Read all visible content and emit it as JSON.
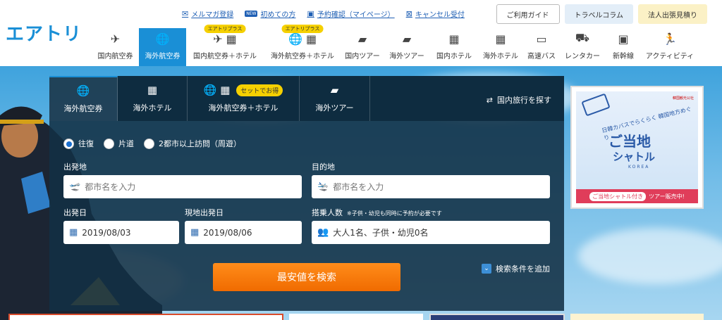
{
  "logo": "エアトリ",
  "toplinks": [
    {
      "icon": "mail-icon",
      "label": "メルマガ登録"
    },
    {
      "icon": "new-badge-icon",
      "badge": "NEW",
      "label": "初めての方"
    },
    {
      "icon": "calendar-check-icon",
      "label": "予約確認（マイページ）"
    },
    {
      "icon": "calendar-cancel-icon",
      "label": "キャンセル受付"
    }
  ],
  "topbuttons": {
    "guide": "ご利用ガイド",
    "travel": "トラベルコラム",
    "corporate": "法人出張見積り"
  },
  "nav": [
    {
      "icon": "airplane-icon",
      "label": "国内航空券",
      "active": false
    },
    {
      "icon": "globe-plane-icon",
      "label": "海外航空券",
      "active": true
    },
    {
      "icon": "airplane-hotel-icon",
      "label": "国内航空券＋ホテル",
      "badge": "エアトリプラス"
    },
    {
      "icon": "globe-hotel-icon",
      "label": "海外航空券＋ホテル",
      "badge": "エアトリプラス"
    },
    {
      "icon": "suitcase-icon",
      "label": "国内ツアー"
    },
    {
      "icon": "globe-suitcase-icon",
      "label": "海外ツアー"
    },
    {
      "icon": "hotel-icon",
      "label": "国内ホテル"
    },
    {
      "icon": "building-icon",
      "label": "海外ホテル"
    },
    {
      "icon": "bus-icon",
      "label": "高速バス"
    },
    {
      "icon": "car-icon",
      "label": "レンタカー"
    },
    {
      "icon": "train-icon",
      "label": "新幹線"
    },
    {
      "icon": "running-icon",
      "label": "アクティビティ"
    }
  ],
  "search": {
    "tabs": [
      {
        "icon": "globe-plane-icon",
        "label": "海外航空券"
      },
      {
        "icon": "building-icon",
        "label": "海外ホテル"
      },
      {
        "icon": "globe-hotel-icon",
        "label": "海外航空券＋ホテル",
        "badge": "セットでお得"
      },
      {
        "icon": "suitcase-icon",
        "label": "海外ツアー"
      }
    ],
    "domestic_link": "国内旅行を探す",
    "trip_types": [
      "往復",
      "片道",
      "2都市以上訪問（周遊）"
    ],
    "departure_label": "出発地",
    "departure_placeholder": "都市名を入力",
    "destination_label": "目的地",
    "destination_placeholder": "都市名を入力",
    "depart_date_label": "出発日",
    "depart_date": "2019/08/03",
    "return_date_label": "現地出発日",
    "return_date": "2019/08/06",
    "passengers_label": "搭乗人数",
    "passengers_note": "※子供・幼児も同時に予約が必要です",
    "passengers_value": "大人1名、子供・幼児0名",
    "search_button": "最安値を検索",
    "add_conditions": "検索条件を追加"
  },
  "ad": {
    "small_text": "日韓カバスでらくらく 韓国地方めぐり",
    "title": "ご当地",
    "subtitle": "シャトル",
    "korea": "KOREA",
    "footer_pill": "ご当地シャトル付き",
    "footer_text": "ツアー販売中!",
    "sponsor": "韓国観光公社"
  }
}
